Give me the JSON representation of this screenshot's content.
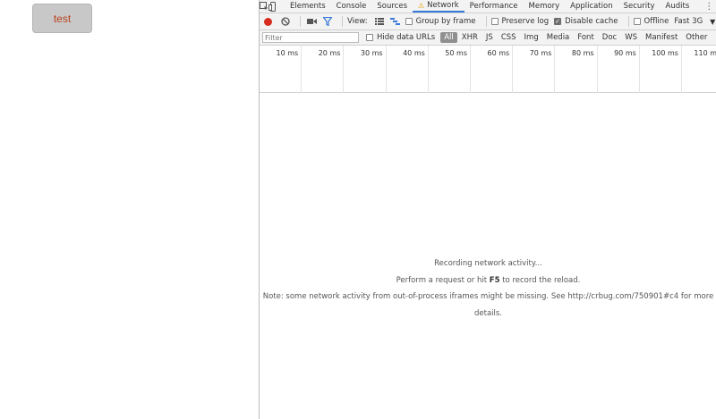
{
  "page": {
    "test_button_label": "test"
  },
  "devtools": {
    "tabs": [
      {
        "label": "Elements"
      },
      {
        "label": "Console"
      },
      {
        "label": "Sources"
      },
      {
        "label": "Network",
        "active": true,
        "warning": true
      },
      {
        "label": "Performance"
      },
      {
        "label": "Memory"
      },
      {
        "label": "Application"
      },
      {
        "label": "Security"
      },
      {
        "label": "Audits"
      }
    ],
    "toolbar": {
      "view_label": "View:",
      "group_by_frame": {
        "label": "Group by frame",
        "checked": false
      },
      "preserve_log": {
        "label": "Preserve log",
        "checked": false
      },
      "disable_cache": {
        "label": "Disable cache",
        "checked": true
      },
      "offline": {
        "label": "Offline",
        "checked": false
      },
      "throttling": "Fast 3G"
    },
    "filter": {
      "placeholder": "Filter",
      "hide_data_urls": {
        "label": "Hide data URLs",
        "checked": false
      },
      "types": [
        "All",
        "XHR",
        "JS",
        "CSS",
        "Img",
        "Media",
        "Font",
        "Doc",
        "WS",
        "Manifest",
        "Other"
      ],
      "active_type": "All"
    },
    "timeline": {
      "ticks": [
        "10 ms",
        "20 ms",
        "30 ms",
        "40 ms",
        "50 ms",
        "60 ms",
        "70 ms",
        "80 ms",
        "90 ms",
        "100 ms",
        "110 ms"
      ]
    },
    "empty_state": {
      "line1": "Recording network activity...",
      "line2_pre": "Perform a request or hit ",
      "line2_key": "F5",
      "line2_post": " to record the reload.",
      "line3": "Note: some network activity from out-of-process iframes might be missing. See http://crbug.com/750901#c4 for more",
      "line4": "details."
    },
    "colors": {
      "record": "#d62d20",
      "accent": "#3879d9",
      "warning": "#e8a000",
      "test_button_text": "#b8421c"
    }
  }
}
